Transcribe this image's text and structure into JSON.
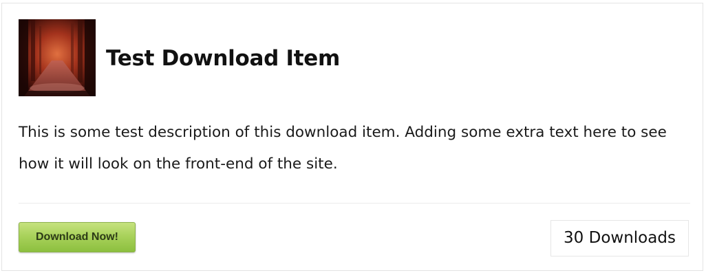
{
  "item": {
    "title": "Test Download Item",
    "description": "This is some test description of this download item. Adding some extra text here to see how it will look on the front-end of the site.",
    "download_button_label": "Download Now!",
    "download_count_text": "30 Downloads",
    "thumbnail_icon": "forest-path-image"
  },
  "colors": {
    "button_green": "#a9d25b",
    "border": "#e3e3e3",
    "text": "#111111"
  }
}
